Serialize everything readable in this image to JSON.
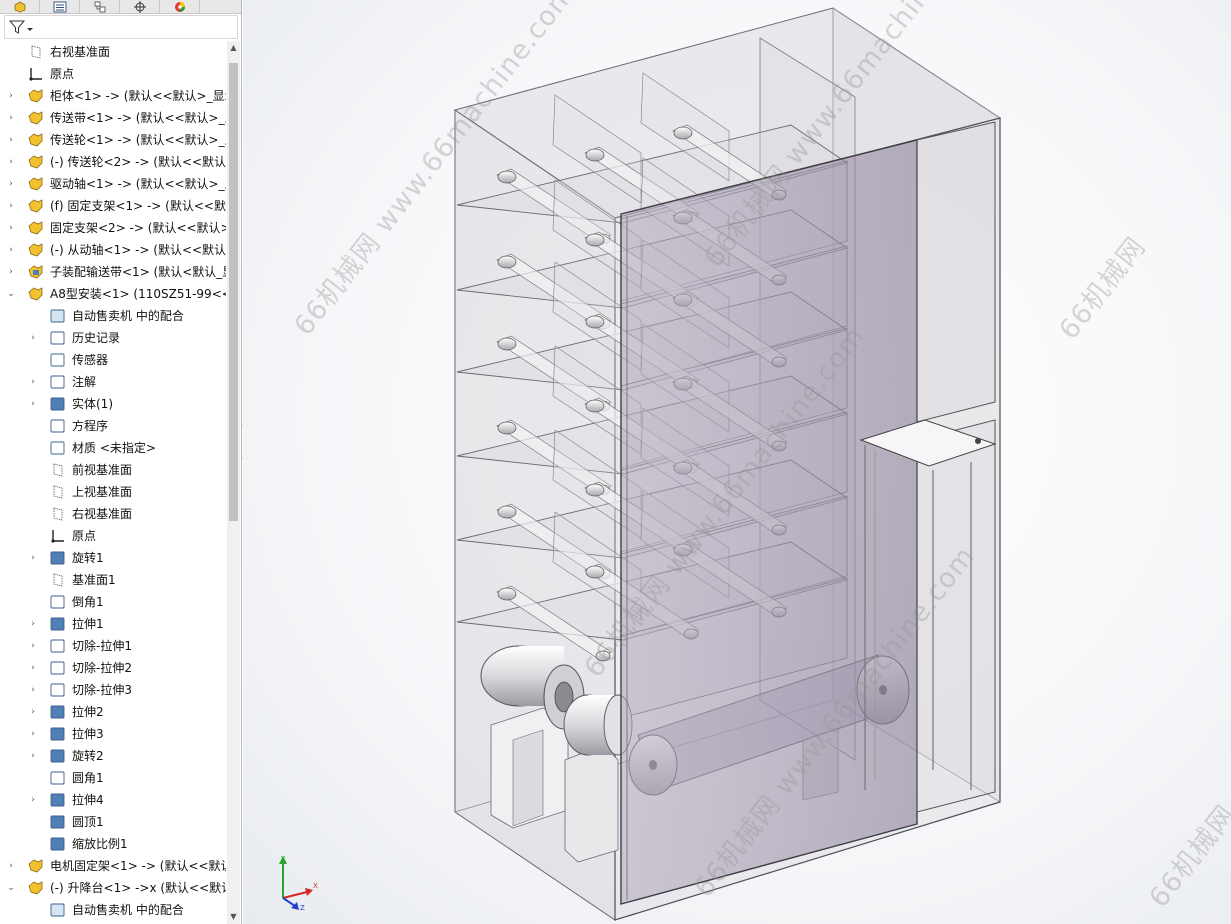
{
  "panel_tabs": [
    {
      "name": "feature-manager-tab",
      "icon": "part-icon"
    },
    {
      "name": "property-manager-tab",
      "icon": "list-icon"
    },
    {
      "name": "configuration-manager-tab",
      "icon": "config-icon"
    },
    {
      "name": "dimxpert-tab",
      "icon": "crosshair-icon"
    },
    {
      "name": "display-manager-tab",
      "icon": "color-wheel-icon"
    }
  ],
  "filter": {
    "icon": "funnel-icon"
  },
  "tree": [
    {
      "level": 1,
      "arrow": "",
      "icon": "plane",
      "label": "右视基准面"
    },
    {
      "level": 1,
      "arrow": "",
      "icon": "origin",
      "label": "原点"
    },
    {
      "level": 1,
      "arrow": "›",
      "icon": "part",
      "label": "柜体<1> -> (默认<<默认>_显示"
    },
    {
      "level": 1,
      "arrow": "›",
      "icon": "part",
      "label": "传送带<1> -> (默认<<默认>_显"
    },
    {
      "level": 1,
      "arrow": "›",
      "icon": "part",
      "label": "传送轮<1> -> (默认<<默认>_显"
    },
    {
      "level": 1,
      "arrow": "›",
      "icon": "part",
      "label": "(-) 传送轮<2> -> (默认<<默认>"
    },
    {
      "level": 1,
      "arrow": "›",
      "icon": "part",
      "label": "驱动轴<1> -> (默认<<默认>_显"
    },
    {
      "level": 1,
      "arrow": "›",
      "icon": "part",
      "label": "(f) 固定支架<1> -> (默认<<默认"
    },
    {
      "level": 1,
      "arrow": "›",
      "icon": "part",
      "label": "固定支架<2> -> (默认<<默认>"
    },
    {
      "level": 1,
      "arrow": "›",
      "icon": "part",
      "label": "(-) 从动轴<1> -> (默认<<默认>"
    },
    {
      "level": 1,
      "arrow": "›",
      "icon": "assembly",
      "label": "子装配输送带<1> (默认<默认_显"
    },
    {
      "level": 1,
      "arrow": "⌄",
      "icon": "part",
      "label": "A8型安装<1> (110SZ51-99<<1"
    },
    {
      "level": 2,
      "arrow": "",
      "icon": "mates",
      "label": "自动售卖机 中的配合"
    },
    {
      "level": 2,
      "arrow": "›",
      "icon": "history",
      "label": "历史记录"
    },
    {
      "level": 2,
      "arrow": "",
      "icon": "sensor",
      "label": "传感器"
    },
    {
      "level": 2,
      "arrow": "›",
      "icon": "annotation",
      "label": "注解"
    },
    {
      "level": 2,
      "arrow": "›",
      "icon": "solid",
      "label": "实体(1)"
    },
    {
      "level": 2,
      "arrow": "",
      "icon": "equation",
      "label": "方程序"
    },
    {
      "level": 2,
      "arrow": "",
      "icon": "material",
      "label": "材质 <未指定>"
    },
    {
      "level": 2,
      "arrow": "",
      "icon": "plane",
      "label": "前视基准面"
    },
    {
      "level": 2,
      "arrow": "",
      "icon": "plane",
      "label": "上视基准面"
    },
    {
      "level": 2,
      "arrow": "",
      "icon": "plane",
      "label": "右视基准面"
    },
    {
      "level": 2,
      "arrow": "",
      "icon": "origin",
      "label": "原点"
    },
    {
      "level": 2,
      "arrow": "›",
      "icon": "revolve",
      "label": "旋转1"
    },
    {
      "level": 2,
      "arrow": "",
      "icon": "plane",
      "label": "基准面1"
    },
    {
      "level": 2,
      "arrow": "",
      "icon": "chamfer",
      "label": "倒角1"
    },
    {
      "level": 2,
      "arrow": "›",
      "icon": "extrude",
      "label": "拉伸1"
    },
    {
      "level": 2,
      "arrow": "›",
      "icon": "cut",
      "label": "切除-拉伸1"
    },
    {
      "level": 2,
      "arrow": "›",
      "icon": "cut",
      "label": "切除-拉伸2"
    },
    {
      "level": 2,
      "arrow": "›",
      "icon": "cut",
      "label": "切除-拉伸3"
    },
    {
      "level": 2,
      "arrow": "›",
      "icon": "extrude",
      "label": "拉伸2"
    },
    {
      "level": 2,
      "arrow": "›",
      "icon": "extrude",
      "label": "拉伸3"
    },
    {
      "level": 2,
      "arrow": "›",
      "icon": "revolve",
      "label": "旋转2"
    },
    {
      "level": 2,
      "arrow": "",
      "icon": "fillet",
      "label": "圆角1"
    },
    {
      "level": 2,
      "arrow": "›",
      "icon": "extrude",
      "label": "拉伸4"
    },
    {
      "level": 2,
      "arrow": "",
      "icon": "dome",
      "label": "圆顶1"
    },
    {
      "level": 2,
      "arrow": "",
      "icon": "scale",
      "label": "缩放比例1"
    },
    {
      "level": 1,
      "arrow": "›",
      "icon": "part",
      "label": "电机固定架<1> -> (默认<<默认"
    },
    {
      "level": 1,
      "arrow": "⌄",
      "icon": "part",
      "label": "(-) 升降台<1> ->x (默认<<默认"
    },
    {
      "level": 2,
      "arrow": "",
      "icon": "mates",
      "label": "自动售卖机 中的配合"
    }
  ],
  "watermarks": [
    {
      "text": "66机械网 www.66machine.com"
    },
    {
      "text": "66机械网 www.66machine.com"
    },
    {
      "text": "66机械网 www.66machine.com"
    },
    {
      "text": "66机械网 www.66machine.com"
    },
    {
      "text": "66机械网"
    },
    {
      "text": "66机械网"
    }
  ],
  "triad": {
    "x": "X",
    "y": "Y",
    "z": "Z"
  },
  "colors": {
    "tree_icon_part": "#f2c12e",
    "tree_icon_feature": "#4f7fb6",
    "glass_fill": "#c9c3cf",
    "door": "#9d8fa8"
  }
}
